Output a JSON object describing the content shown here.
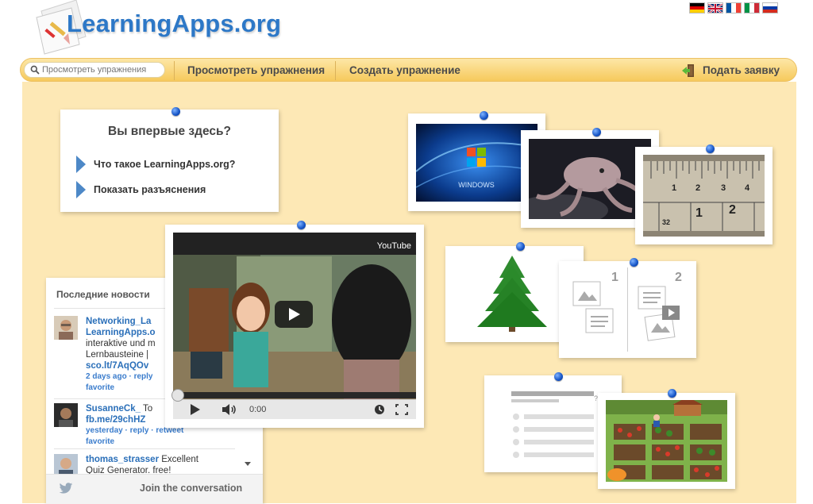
{
  "header": {
    "logo_text": "LearningApps.org",
    "languages": [
      {
        "code": "de",
        "icon": "flag-germany-icon"
      },
      {
        "code": "en",
        "icon": "flag-uk-icon"
      },
      {
        "code": "fr",
        "icon": "flag-france-icon"
      },
      {
        "code": "it",
        "icon": "flag-italy-icon"
      },
      {
        "code": "ru",
        "icon": "flag-russia-icon"
      }
    ]
  },
  "nav": {
    "search_placeholder": "Просмотреть упражнения",
    "browse_label": "Просмотреть упражнения",
    "create_label": "Создать упражнение",
    "apply_label": "Подать заявку"
  },
  "welcome": {
    "title": "Вы впервые здесь?",
    "links": [
      "Что такое LearningApps.org?",
      "Показать разъяснения"
    ]
  },
  "news": {
    "heading": "Последние новости",
    "items": [
      {
        "user": "Networking_La",
        "line1": "LearningApps.o",
        "line2": "interaktive und m",
        "line3": "Lernbausteine |",
        "link": "sco.lt/7AqQOv",
        "meta": "2 days ago · reply",
        "meta2": "favorite"
      },
      {
        "user": "SusanneCk_",
        "text": "To",
        "link": "fb.me/29chHZ",
        "meta": "yesterday · reply · retweet",
        "meta2": "favorite"
      },
      {
        "user": "thomas_strasser",
        "text": "Excellent",
        "line2": "Quiz Generator. free!"
      }
    ],
    "join_label": "Join the conversation"
  },
  "video": {
    "provider": "YouTube",
    "time": "0:00",
    "progress": 0.0
  },
  "gallery": {
    "ruler_numbers": [
      "1",
      "2",
      "3",
      "4",
      "1",
      "2",
      "32"
    ],
    "match_numbers": [
      "1",
      "2"
    ],
    "windows_caption": "WINDOWS"
  },
  "colors": {
    "accent_blue": "#2d78c7",
    "board": "#fde8b5",
    "nav_bar": "#f6c95c"
  }
}
